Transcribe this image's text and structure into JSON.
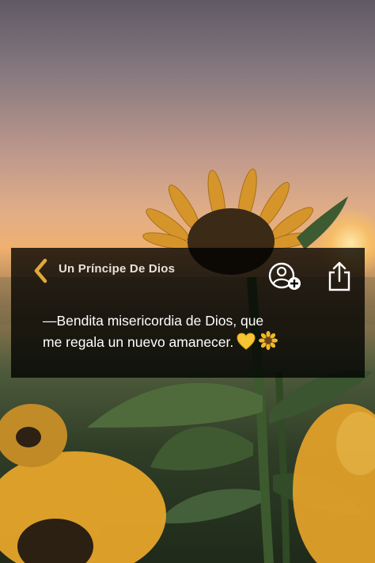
{
  "header": {
    "title": "Un Príncipe De Dios"
  },
  "icons": {
    "back": "chevron-left-icon",
    "add_friend": "user-plus-icon",
    "share": "share-icon"
  },
  "post": {
    "line1": "—Bendita misericordia de Dios, que",
    "line2": "me regala un nuevo amanecer.",
    "emojis": [
      "yellow-heart-emoji",
      "sunflower-emoji"
    ]
  },
  "colors": {
    "accent_gold": "#e0a83a",
    "panel_bg": "#000000",
    "text": "#ffffff"
  }
}
